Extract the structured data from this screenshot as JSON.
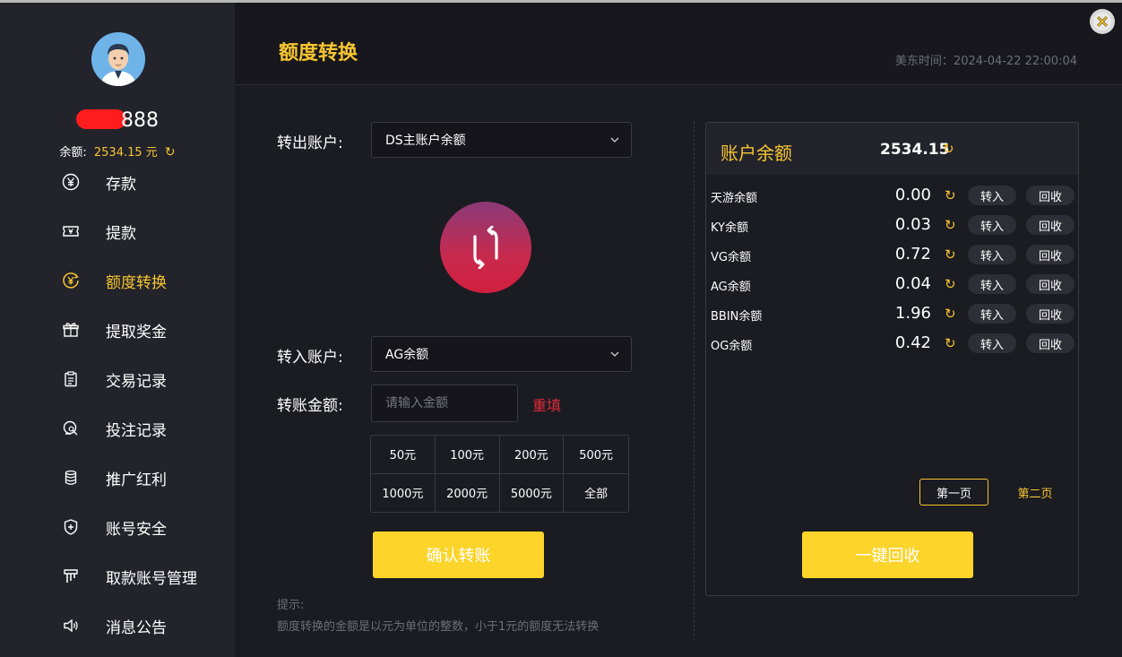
{
  "sidebar": {
    "username_suffix": "888",
    "balance_label": "余额:",
    "balance_value": "2534.15 元",
    "items": [
      {
        "label": "存款"
      },
      {
        "label": "提款"
      },
      {
        "label": "额度转换"
      },
      {
        "label": "提取奖金"
      },
      {
        "label": "交易记录"
      },
      {
        "label": "投注记录"
      },
      {
        "label": "推广红利"
      },
      {
        "label": "账号安全"
      },
      {
        "label": "取款账号管理"
      },
      {
        "label": "消息公告"
      }
    ]
  },
  "header": {
    "title": "额度转换",
    "time": "美东时间：2024-04-22 22:00:04"
  },
  "form": {
    "from_label": "转出账户:",
    "from_value": "DS主账户余额",
    "to_label": "转入账户:",
    "to_value": "AG余额",
    "amount_label": "转账金额:",
    "amount_placeholder": "请输入金额",
    "reset_label": "重填",
    "quick_amounts": [
      "50元",
      "100元",
      "200元",
      "500元",
      "1000元",
      "2000元",
      "5000元",
      "全部"
    ],
    "confirm_label": "确认转账",
    "tip_title": "提示:",
    "tip_text": "额度转换的金额是以元为单位的整数，小于1元的额度无法转换"
  },
  "panel": {
    "title": "账户余额",
    "total": "2534.15",
    "transfer_in_label": "转入",
    "recycle_label": "回收",
    "platforms": [
      {
        "name": "天游余额",
        "value": "0.00"
      },
      {
        "name": "KY余额",
        "value": "0.03"
      },
      {
        "name": "VG余额",
        "value": "0.72"
      },
      {
        "name": "AG余额",
        "value": "0.04"
      },
      {
        "name": "BBIN余额",
        "value": "1.96"
      },
      {
        "name": "OG余额",
        "value": "0.42"
      }
    ],
    "page1_label": "第一页",
    "page2_label": "第二页",
    "recycle_all_label": "一键回收"
  },
  "colors": {
    "accent": "#f7c531",
    "button": "#fcd42a",
    "danger": "#e02a3a"
  }
}
